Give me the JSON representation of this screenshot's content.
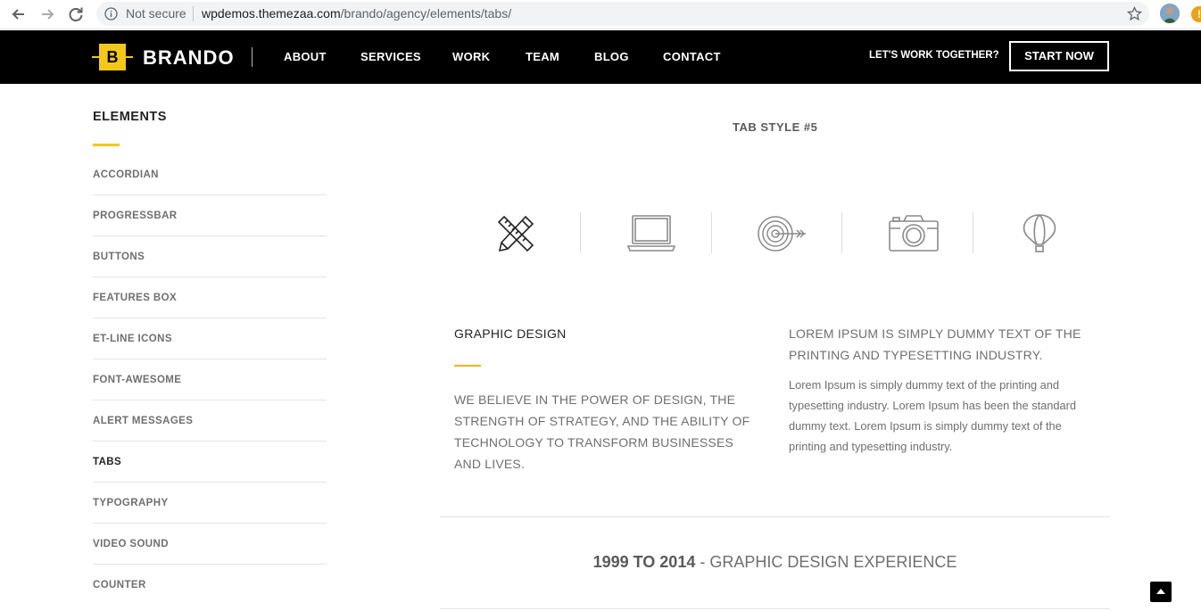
{
  "browser": {
    "security_label": "Not secure",
    "url_host": "wpdemos.themezaa.com",
    "url_path": "/brando/agency/elements/tabs/"
  },
  "header": {
    "logo_letter": "B",
    "logo_text": "BRANDO",
    "nav": [
      "ABOUT",
      "SERVICES",
      "WORK",
      "TEAM",
      "BLOG",
      "CONTACT"
    ],
    "cta_text": "LET'S WORK TOGETHER?",
    "cta_button": "START NOW",
    "accent_color": "#f6c71b"
  },
  "sidebar": {
    "title": "ELEMENTS",
    "items": [
      {
        "label": "ACCORDIAN"
      },
      {
        "label": "PROGRESSBAR"
      },
      {
        "label": "BUTTONS"
      },
      {
        "label": "FEATURES BOX"
      },
      {
        "label": "ET-LINE ICONS"
      },
      {
        "label": "FONT-AWESOME"
      },
      {
        "label": "ALERT MESSAGES"
      },
      {
        "label": "TABS"
      },
      {
        "label": "TYPOGRAPHY"
      },
      {
        "label": "VIDEO SOUND"
      },
      {
        "label": "COUNTER"
      }
    ],
    "active_item": "TABS"
  },
  "main": {
    "section_title": "TAB STYLE #5",
    "tabs": [
      {
        "icon": "pencil-ruler-icon"
      },
      {
        "icon": "laptop-icon"
      },
      {
        "icon": "target-arrow-icon"
      },
      {
        "icon": "camera-icon"
      },
      {
        "icon": "hot-air-balloon-icon"
      }
    ],
    "active_tab": 0,
    "content": {
      "title": "GRAPHIC DESIGN",
      "lead": "WE BELIEVE IN THE POWER OF DESIGN, THE STRENGTH OF STRATEGY, AND THE ABILITY OF TECHNOLOGY TO TRANSFORM BUSINESSES AND LIVES.",
      "heading": "LOREM IPSUM IS SIMPLY DUMMY TEXT OF THE PRINTING AND TYPESETTING INDUSTRY.",
      "body": "Lorem Ipsum is simply dummy text of the printing and typesetting industry. Lorem Ipsum has been the standard dummy text. Lorem Ipsum is simply dummy text of the printing and typesetting industry."
    },
    "experience": {
      "years": "1999 TO 2014",
      "text": " - GRAPHIC DESIGN EXPERIENCE"
    }
  }
}
